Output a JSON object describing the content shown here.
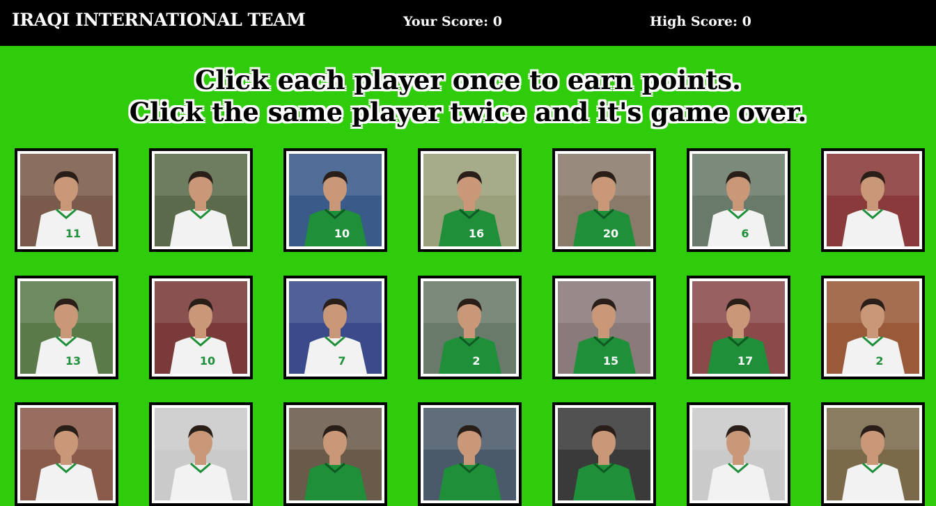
{
  "header": {
    "title": "IRAQI INTERNATIONAL TEAM",
    "your_score_label": "Your Score: 0",
    "high_score_label": "High Score: 0"
  },
  "instructions": {
    "line1": "Click each player once to earn points.",
    "line2": "Click the same player twice and it's game over."
  },
  "colors": {
    "background": "#2ecc0b",
    "navbar": "#000000",
    "jersey_green": "#1f8f3a",
    "jersey_white": "#f2f2f2"
  },
  "cards": [
    {
      "name": "player-card-1",
      "kit": "white",
      "number": "11",
      "bg": "#7a5a4a"
    },
    {
      "name": "player-card-2",
      "kit": "white",
      "number": "",
      "bg": "#5a6a4a"
    },
    {
      "name": "player-card-3",
      "kit": "green",
      "number": "10",
      "bg": "#3a5a8a"
    },
    {
      "name": "player-card-4",
      "kit": "green",
      "number": "16",
      "bg": "#9aa07a"
    },
    {
      "name": "player-card-5",
      "kit": "green",
      "number": "20",
      "bg": "#8a7a6a"
    },
    {
      "name": "player-card-6",
      "kit": "white",
      "number": "6",
      "bg": "#6a7a6a"
    },
    {
      "name": "player-card-7",
      "kit": "white",
      "number": "",
      "bg": "#8a3a3a"
    },
    {
      "name": "player-card-8",
      "kit": "white",
      "number": "13",
      "bg": "#5a7a4a"
    },
    {
      "name": "player-card-9",
      "kit": "white",
      "number": "10",
      "bg": "#7a3a3a"
    },
    {
      "name": "player-card-10",
      "kit": "white",
      "number": "7",
      "bg": "#3a4a8a"
    },
    {
      "name": "player-card-11",
      "kit": "green",
      "number": "2",
      "bg": "#6a7a6a"
    },
    {
      "name": "player-card-12",
      "kit": "green",
      "number": "15",
      "bg": "#8a7a7a"
    },
    {
      "name": "player-card-13",
      "kit": "green",
      "number": "17",
      "bg": "#8a4a4a"
    },
    {
      "name": "player-card-14",
      "kit": "white",
      "number": "2",
      "bg": "#9a5a3a"
    },
    {
      "name": "player-card-15",
      "kit": "white",
      "number": "",
      "bg": "#8a5a4a"
    },
    {
      "name": "player-card-16",
      "kit": "white",
      "number": "",
      "bg": "#cacaca"
    },
    {
      "name": "player-card-17",
      "kit": "green",
      "number": "",
      "bg": "#6a5a4a"
    },
    {
      "name": "player-card-18",
      "kit": "green",
      "number": "",
      "bg": "#4a5a6a"
    },
    {
      "name": "player-card-19",
      "kit": "green",
      "number": "",
      "bg": "#3a3a3a"
    },
    {
      "name": "player-card-20",
      "kit": "white",
      "number": "",
      "bg": "#cacaca"
    },
    {
      "name": "player-card-21",
      "kit": "white",
      "number": "",
      "bg": "#7a6a4a"
    }
  ]
}
